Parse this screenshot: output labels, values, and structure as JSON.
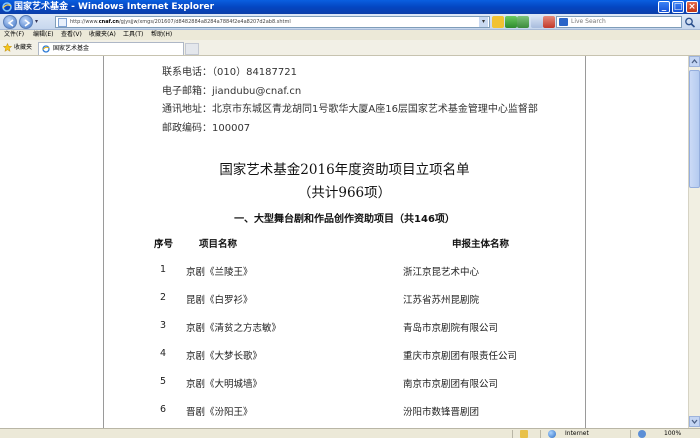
{
  "window": {
    "title": "国家艺术基金 - Windows Internet Explorer"
  },
  "address_bar": {
    "url_prefix": "http://www.",
    "url_domain": "cnaf.cn",
    "url_rest": "/gjysjjw/xmgs/201607/d8482884a8284a7884f2e4a8207d2ab8.shtml"
  },
  "search": {
    "placeholder": "Live Search"
  },
  "menu": [
    {
      "label": "文件(F)"
    },
    {
      "label": "编辑(E)"
    },
    {
      "label": "查看(V)"
    },
    {
      "label": "收藏夹(A)"
    },
    {
      "label": "工具(T)"
    },
    {
      "label": "帮助(H)"
    }
  ],
  "favorites": {
    "label": "收藏夹"
  },
  "tab": {
    "title": "国家艺术基金"
  },
  "contact": {
    "phone": "联系电话：（010）84187721",
    "email": "电子邮箱：jiandubu@cnaf.cn",
    "address": "通讯地址：北京市东城区青龙胡同1号歌华大厦A座16层国家艺术基金管理中心监督部",
    "postcode": "邮政编码：100007"
  },
  "document": {
    "title": "国家艺术基金2016年度资助项目立项名单",
    "subtitle": "（共计966项）",
    "section_heading": "一、大型舞台剧和作品创作资助项目（共146项）"
  },
  "table": {
    "headers": [
      "序号",
      "项目名称",
      "申报主体名称"
    ],
    "rows": [
      {
        "no": "1",
        "name": "京剧《兰陵王》",
        "applicant": "浙江京昆艺术中心"
      },
      {
        "no": "2",
        "name": "昆剧《白罗衫》",
        "applicant": "江苏省苏州昆剧院"
      },
      {
        "no": "3",
        "name": "京剧《清贫之方志敏》",
        "applicant": "青岛市京剧院有限公司"
      },
      {
        "no": "4",
        "name": "京剧《大梦长歌》",
        "applicant": "重庆市京剧团有限责任公司"
      },
      {
        "no": "5",
        "name": "京剧《大明城墙》",
        "applicant": "南京市京剧团有限公司"
      },
      {
        "no": "6",
        "name": "晋剧《汾阳王》",
        "applicant": "汾阳市数锋晋剧团"
      }
    ]
  },
  "status_bar": {
    "zone": "Internet",
    "zoom": "100%"
  }
}
